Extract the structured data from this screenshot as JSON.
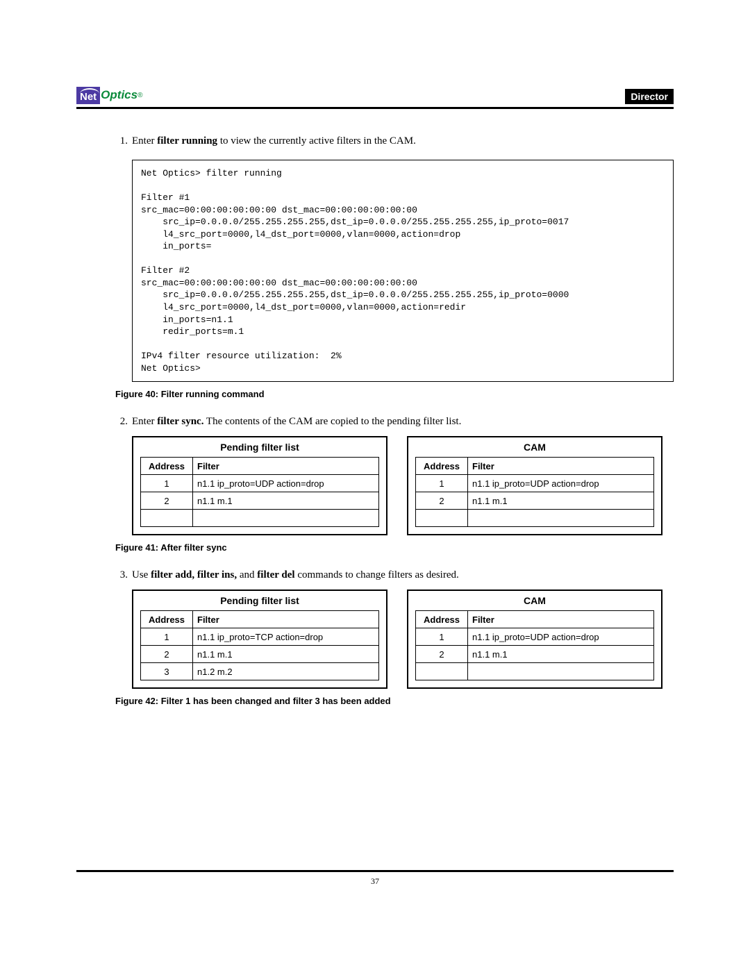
{
  "header": {
    "logo_net": "Net",
    "logo_optics": "Optics",
    "logo_reg": "®",
    "badge": "Director"
  },
  "steps": {
    "s1": {
      "num": "1.",
      "pre": "Enter ",
      "bold": "filter running",
      "post": " to view the currently active filters in the CAM."
    },
    "s2": {
      "num": "2.",
      "pre": "Enter ",
      "bold": "filter sync.",
      "post": " The contents of the CAM are copied to the pending filter list."
    },
    "s3": {
      "num": "3.",
      "pre": "Use ",
      "bold": "filter add, filter ins,",
      "mid": " and ",
      "bold2": "filter del",
      "post": " commands to change filters as desired."
    }
  },
  "codebox": "Net Optics> filter running\n\nFilter #1\nsrc_mac=00:00:00:00:00:00 dst_mac=00:00:00:00:00:00\n    src_ip=0.0.0.0/255.255.255.255,dst_ip=0.0.0.0/255.255.255.255,ip_proto=0017\n    l4_src_port=0000,l4_dst_port=0000,vlan=0000,action=drop\n    in_ports=\n\nFilter #2\nsrc_mac=00:00:00:00:00:00 dst_mac=00:00:00:00:00:00\n    src_ip=0.0.0.0/255.255.255.255,dst_ip=0.0.0.0/255.255.255.255,ip_proto=0000\n    l4_src_port=0000,l4_dst_port=0000,vlan=0000,action=redir\n    in_ports=n1.1\n    redir_ports=m.1\n\nIPv4 filter resource utilization:  2%\nNet Optics>",
  "captions": {
    "fig40": "Figure 40: Filter running command",
    "fig41": "Figure 41: After filter sync",
    "fig42": "Figure 42: Filter 1 has been changed and filter 3 has been added"
  },
  "table_headers": {
    "pending": "Pending filter list",
    "cam": "CAM",
    "address": "Address",
    "filter": "Filter"
  },
  "tables41": {
    "pending": [
      {
        "addr": "1",
        "filter": "n1.1 ip_proto=UDP action=drop"
      },
      {
        "addr": "2",
        "filter": "n1.1 m.1"
      },
      {
        "addr": "",
        "filter": ""
      }
    ],
    "cam": [
      {
        "addr": "1",
        "filter": "n1.1 ip_proto=UDP action=drop"
      },
      {
        "addr": "2",
        "filter": "n1.1 m.1"
      },
      {
        "addr": "",
        "filter": ""
      }
    ]
  },
  "tables42": {
    "pending": [
      {
        "addr": "1",
        "filter": "n1.1 ip_proto=TCP action=drop"
      },
      {
        "addr": "2",
        "filter": "n1.1 m.1"
      },
      {
        "addr": "3",
        "filter": "n1.2 m.2"
      }
    ],
    "cam": [
      {
        "addr": "1",
        "filter": "n1.1 ip_proto=UDP action=drop"
      },
      {
        "addr": "2",
        "filter": "n1.1 m.1"
      },
      {
        "addr": "",
        "filter": ""
      }
    ]
  },
  "footer": {
    "page_number": "37"
  }
}
